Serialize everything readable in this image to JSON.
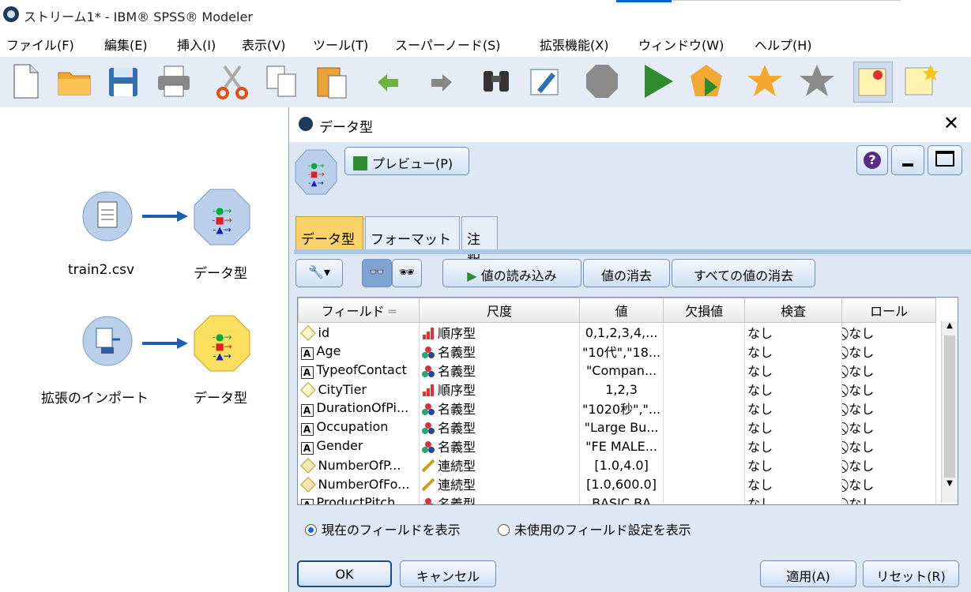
{
  "window": {
    "title": "ストリーム1* - IBM® SPSS® Modeler"
  },
  "menu": [
    "ファイル(F)",
    "編集(E)",
    "挿入(I)",
    "表示(V)",
    "ツール(T)",
    "スーパーノード(S)",
    "拡張機能(X)",
    "ウィンドウ(W)",
    "ヘルプ(H)"
  ],
  "toolbar_icons": [
    "new-document-icon",
    "open-folder-icon",
    "save-icon",
    "print-icon",
    "cut-icon",
    "copy-icon",
    "paste-icon",
    "undo-icon",
    "redo-icon",
    "find-icon",
    "edit-icon",
    "stop-icon",
    "run-icon",
    "run-selection-icon",
    "favorite-star-icon",
    "star-add-icon",
    "annotation-pin-icon",
    "new-annotation-icon"
  ],
  "canvas": {
    "nodes": [
      {
        "label": "train2.csv"
      },
      {
        "label": "データ型"
      },
      {
        "label": "拡張のインポート"
      },
      {
        "label": "データ型"
      }
    ]
  },
  "dialog": {
    "title": "データ型",
    "preview_label": "プレビュー(P)",
    "tabs": [
      "データ型",
      "フォーマット",
      "注釈"
    ],
    "actions": {
      "read_values": "値の読み込み",
      "clear_values": "値の消去",
      "clear_all_values": "すべての値の消去"
    },
    "columns": [
      "フィールド",
      "尺度",
      "値",
      "欠損値",
      "検査",
      "ロール"
    ],
    "rows": [
      {
        "icon": "diamond",
        "field": "id",
        "measure_icon": "ordinal",
        "measure": "順序型",
        "values": "0,1,2,3,4,...",
        "missing": "",
        "check": "なし",
        "role": "なし"
      },
      {
        "icon": "string",
        "field": "Age",
        "measure_icon": "nominal",
        "measure": "名義型",
        "values": "\"10代\",\"18...",
        "missing": "",
        "check": "なし",
        "role": "なし"
      },
      {
        "icon": "string",
        "field": "TypeofContact",
        "measure_icon": "nominal",
        "measure": "名義型",
        "values": "\"Compan...",
        "missing": "",
        "check": "なし",
        "role": "なし"
      },
      {
        "icon": "diamond",
        "field": "CityTier",
        "measure_icon": "ordinal",
        "measure": "順序型",
        "values": "1,2,3",
        "missing": "",
        "check": "なし",
        "role": "なし"
      },
      {
        "icon": "string",
        "field": "DurationOfPi...",
        "measure_icon": "nominal",
        "measure": "名義型",
        "values": "\"1020秒\",\"...",
        "missing": "",
        "check": "なし",
        "role": "なし"
      },
      {
        "icon": "string",
        "field": "Occupation",
        "measure_icon": "nominal",
        "measure": "名義型",
        "values": "\"Large Bu...",
        "missing": "",
        "check": "なし",
        "role": "なし"
      },
      {
        "icon": "string",
        "field": "Gender",
        "measure_icon": "nominal",
        "measure": "名義型",
        "values": "\"FE MALE...",
        "missing": "",
        "check": "なし",
        "role": "なし"
      },
      {
        "icon": "real",
        "field": "NumberOfP...",
        "measure_icon": "continuous",
        "measure": "連続型",
        "values": "[1.0,4.0]",
        "missing": "",
        "check": "なし",
        "role": "なし"
      },
      {
        "icon": "real",
        "field": "NumberOfFo...",
        "measure_icon": "continuous",
        "measure": "連続型",
        "values": "[1.0,600.0]",
        "missing": "",
        "check": "なし",
        "role": "なし"
      },
      {
        "icon": "string",
        "field": "ProductPitch",
        "measure_icon": "nominal",
        "measure": "名義型",
        "values": "BASIC BA",
        "missing": "",
        "check": "なし",
        "role": "なし"
      }
    ],
    "radio_current": "現在のフィールドを表示",
    "radio_unused": "未使用のフィールド設定を表示",
    "buttons": {
      "ok": "OK",
      "cancel": "キャンセル",
      "apply": "適用(A)",
      "reset": "リセット(R)"
    }
  }
}
